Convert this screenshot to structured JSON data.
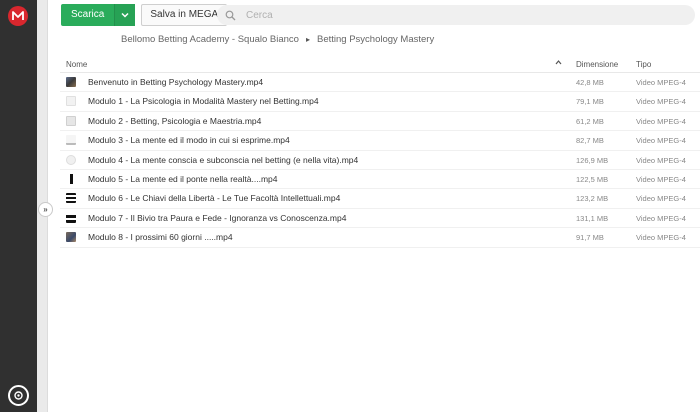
{
  "toolbar": {
    "download_label": "Scarica",
    "save_label": "Salva in MEGA"
  },
  "search": {
    "placeholder": "Cerca"
  },
  "breadcrumb": {
    "parent": "Bellomo Betting Academy - Squalo Bianco",
    "current": "Betting Psychology Mastery"
  },
  "table": {
    "headers": {
      "name": "Nome",
      "size": "Dimensione",
      "type": "Tipo"
    },
    "rows": [
      {
        "name": "Benvenuto in Betting Psychology Mastery.mp4",
        "size": "42,8 MB",
        "type": "Video MPEG-4"
      },
      {
        "name": "Modulo 1 - La Psicologia in Modalità Mastery nel Betting.mp4",
        "size": "79,1 MB",
        "type": "Video MPEG-4"
      },
      {
        "name": "Modulo 2 - Betting, Psicologia e Maestria.mp4",
        "size": "61,2 MB",
        "type": "Video MPEG-4"
      },
      {
        "name": "Modulo 3 - La mente ed il modo in cui si esprime.mp4",
        "size": "82,7 MB",
        "type": "Video MPEG-4"
      },
      {
        "name": "Modulo 4 - La mente conscia e subconscia nel betting (e nella vita).mp4",
        "size": "126,9 MB",
        "type": "Video MPEG-4"
      },
      {
        "name": "Modulo 5 - La mente ed il ponte nella realtà....mp4",
        "size": "122,5 MB",
        "type": "Video MPEG-4"
      },
      {
        "name": "Modulo 6 - Le Chiavi della Libertà - Le Tue Facoltà Intellettuali.mp4",
        "size": "123,2 MB",
        "type": "Video MPEG-4"
      },
      {
        "name": "Modulo 7 - Il Bivio tra Paura e Fede - Ignoranza vs Conoscenza.mp4",
        "size": "131,1 MB",
        "type": "Video MPEG-4"
      },
      {
        "name": "Modulo 8 - I prossimi 60 giorni .....mp4",
        "size": "91,7 MB",
        "type": "Video MPEG-4"
      }
    ]
  },
  "colors": {
    "brand": "#d9272e",
    "download_green": "#2aac5b",
    "sidebar": "#303030"
  },
  "icons": {
    "logo": "mega-logo-icon",
    "search": "search-icon",
    "download_arrow": "chevron-down-icon",
    "sort": "sort-up-icon",
    "expand": "expand-sidebar-icon",
    "settings": "settings-icon"
  }
}
